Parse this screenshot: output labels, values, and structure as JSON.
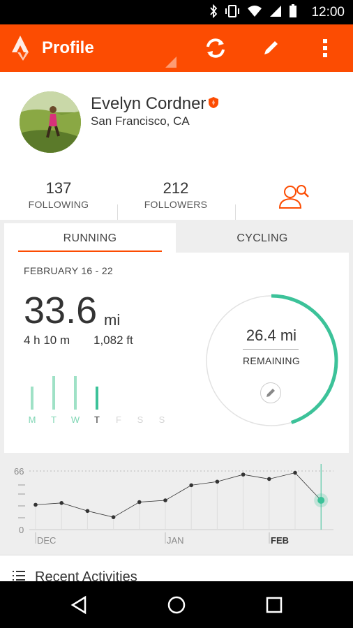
{
  "status_bar": {
    "time": "12:00"
  },
  "app_bar": {
    "title": "Profile",
    "accent": "#fc4c02"
  },
  "profile": {
    "name": "Evelyn Cordner",
    "location": "San Francisco, CA"
  },
  "stats": {
    "following_count": "137",
    "following_label": "FOLLOWING",
    "followers_count": "212",
    "followers_label": "FOLLOWERS"
  },
  "tabs": [
    {
      "label": "RUNNING",
      "selected": true
    },
    {
      "label": "CYCLING",
      "selected": false
    }
  ],
  "weekly": {
    "range": "FEBRUARY 16 - 22",
    "distance": "33.6",
    "distance_unit": "mi",
    "time": "4 h 10 m",
    "elevation": "1,082 ft",
    "days": [
      {
        "label": "M",
        "level": 0.55,
        "active": true,
        "today": false
      },
      {
        "label": "T",
        "level": 0.8,
        "active": true,
        "today": false
      },
      {
        "label": "W",
        "level": 0.8,
        "active": true,
        "today": false
      },
      {
        "label": "T",
        "level": 0.55,
        "active": true,
        "today": true
      },
      {
        "label": "F",
        "level": 0,
        "active": false,
        "today": false
      },
      {
        "label": "S",
        "level": 0,
        "active": false,
        "today": false
      },
      {
        "label": "S",
        "level": 0,
        "active": false,
        "today": false
      }
    ],
    "goal_remaining": "26.4 mi",
    "goal_remaining_label": "REMAINING",
    "goal_progress": 0.45,
    "ring_color": "#3cc299"
  },
  "chart_data": {
    "type": "line",
    "ymax_label": "66",
    "ymin_label": "0",
    "ylim": [
      0,
      66
    ],
    "x_labels": [
      "DEC",
      "JAN",
      "FEB"
    ],
    "values": [
      28,
      30,
      21,
      14,
      31,
      33,
      50,
      54,
      62,
      57,
      64,
      33
    ],
    "highlight_index": 11,
    "line_color": "#333333",
    "highlight_color": "#3cc299"
  },
  "recent": {
    "label": "Recent Activities"
  }
}
